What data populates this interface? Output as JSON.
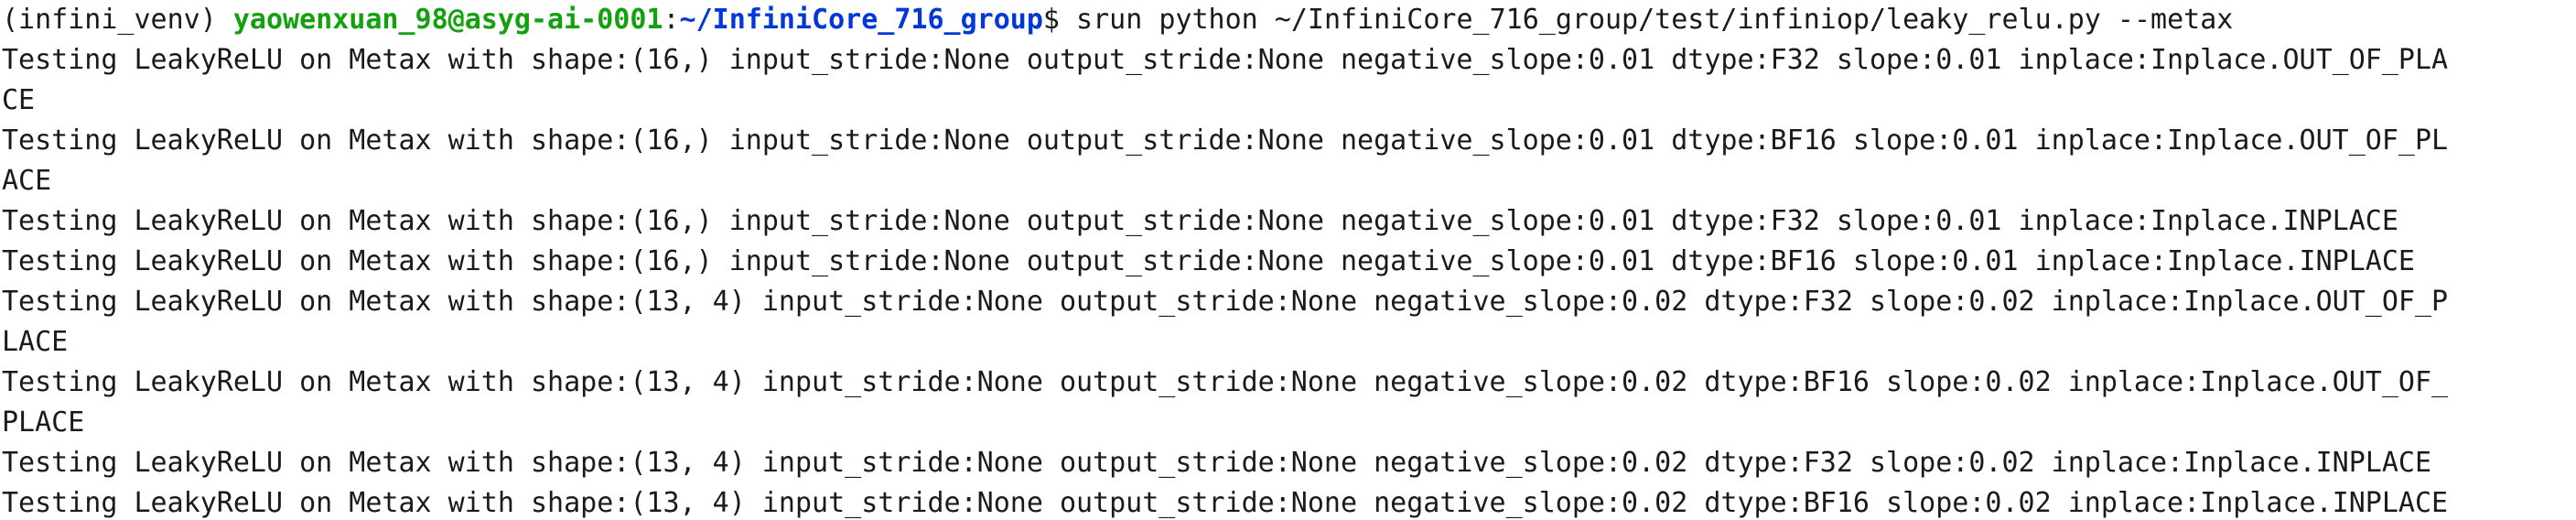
{
  "colors": {
    "background": "#ffffff",
    "foreground": "#1a1a1a",
    "prompt_user": "#13a10e",
    "prompt_path": "#0037da"
  },
  "prompt": {
    "venv": "(infini_venv) ",
    "user_host": "yaowenxuan_98@asyg-ai-0001",
    "colon": ":",
    "path": "~/InfiniCore_716_group",
    "dollar": "$ ",
    "command": "srun python ~/InfiniCore_716_group/test/infiniop/leaky_relu.py --metax"
  },
  "output_lines": [
    "Testing LeakyReLU on Metax with shape:(16,) input_stride:None output_stride:None negative_slope:0.01 dtype:F32 slope:0.01 inplace:Inplace.OUT_OF_PLA",
    "CE",
    "Testing LeakyReLU on Metax with shape:(16,) input_stride:None output_stride:None negative_slope:0.01 dtype:BF16 slope:0.01 inplace:Inplace.OUT_OF_PL",
    "ACE",
    "Testing LeakyReLU on Metax with shape:(16,) input_stride:None output_stride:None negative_slope:0.01 dtype:F32 slope:0.01 inplace:Inplace.INPLACE",
    "Testing LeakyReLU on Metax with shape:(16,) input_stride:None output_stride:None negative_slope:0.01 dtype:BF16 slope:0.01 inplace:Inplace.INPLACE",
    "Testing LeakyReLU on Metax with shape:(13, 4) input_stride:None output_stride:None negative_slope:0.02 dtype:F32 slope:0.02 inplace:Inplace.OUT_OF_P",
    "LACE",
    "Testing LeakyReLU on Metax with shape:(13, 4) input_stride:None output_stride:None negative_slope:0.02 dtype:BF16 slope:0.02 inplace:Inplace.OUT_OF_",
    "PLACE",
    "Testing LeakyReLU on Metax with shape:(13, 4) input_stride:None output_stride:None negative_slope:0.02 dtype:F32 slope:0.02 inplace:Inplace.INPLACE",
    "Testing LeakyReLU on Metax with shape:(13, 4) input_stride:None output_stride:None negative_slope:0.02 dtype:BF16 slope:0.02 inplace:Inplace.INPLACE"
  ]
}
